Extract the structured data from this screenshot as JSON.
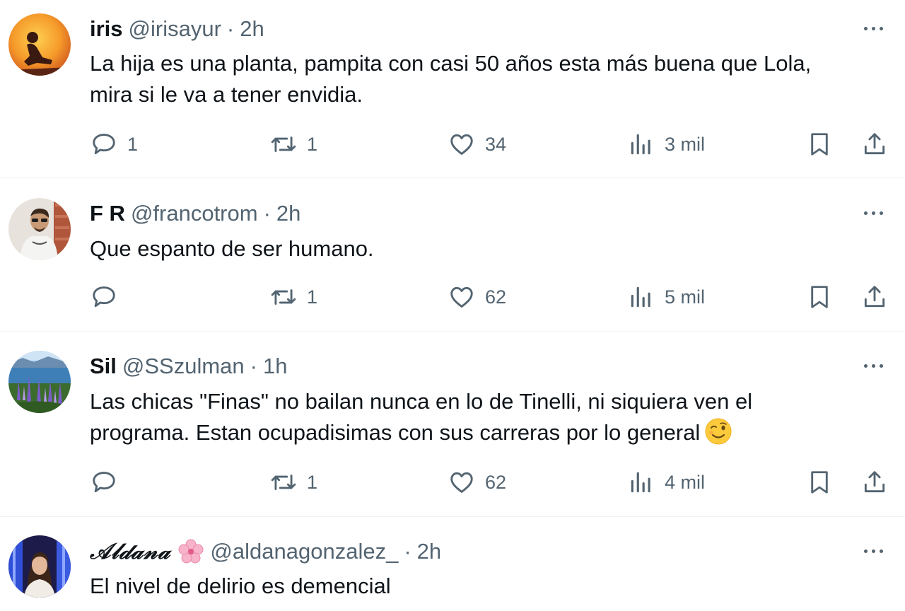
{
  "tweets": [
    {
      "name": "iris",
      "handle": "@irisayur",
      "dot": "·",
      "time": "2h",
      "text_lines": [
        "La hija es una planta, pampita con casi 50 años esta más buena que Lola,",
        "mira si le va a tener envidia."
      ],
      "replies": "1",
      "retweets": "1",
      "likes": "34",
      "views": "3 mil"
    },
    {
      "name": "F R",
      "handle": "@francotrom",
      "dot": "·",
      "time": "2h",
      "text_lines": [
        "Que espanto de ser humano."
      ],
      "replies": "",
      "retweets": "1",
      "likes": "62",
      "views": "5 mil"
    },
    {
      "name": "Sil",
      "handle": "@SSzulman",
      "dot": "·",
      "time": "1h",
      "text_lines": [
        "Las chicas \"Finas\" no bailan nunca en lo de Tinelli, ni siquiera ven el",
        "programa. Estan ocupadisimas con sus carreras por lo general"
      ],
      "replies": "",
      "retweets": "1",
      "likes": "62",
      "views": "4 mil"
    },
    {
      "name": "𝒜𝓁𝒹𝒶𝓃𝒶",
      "handle": "@aldanagonzalez_",
      "dot": "·",
      "time": "2h",
      "text_lines": [
        "El nivel de delirio es demencial"
      ]
    }
  ],
  "icons": {
    "reply": "reply-icon",
    "retweet": "retweet-icon",
    "like": "heart-icon",
    "views": "views-icon",
    "bookmark": "bookmark-icon",
    "share": "share-icon",
    "more": "more-icon",
    "wink": "wink-emoji-icon",
    "flower": "cherry-blossom-icon"
  },
  "colors": {
    "text": "#0f1419",
    "secondary": "#536471",
    "separator": "#eff3f4"
  }
}
